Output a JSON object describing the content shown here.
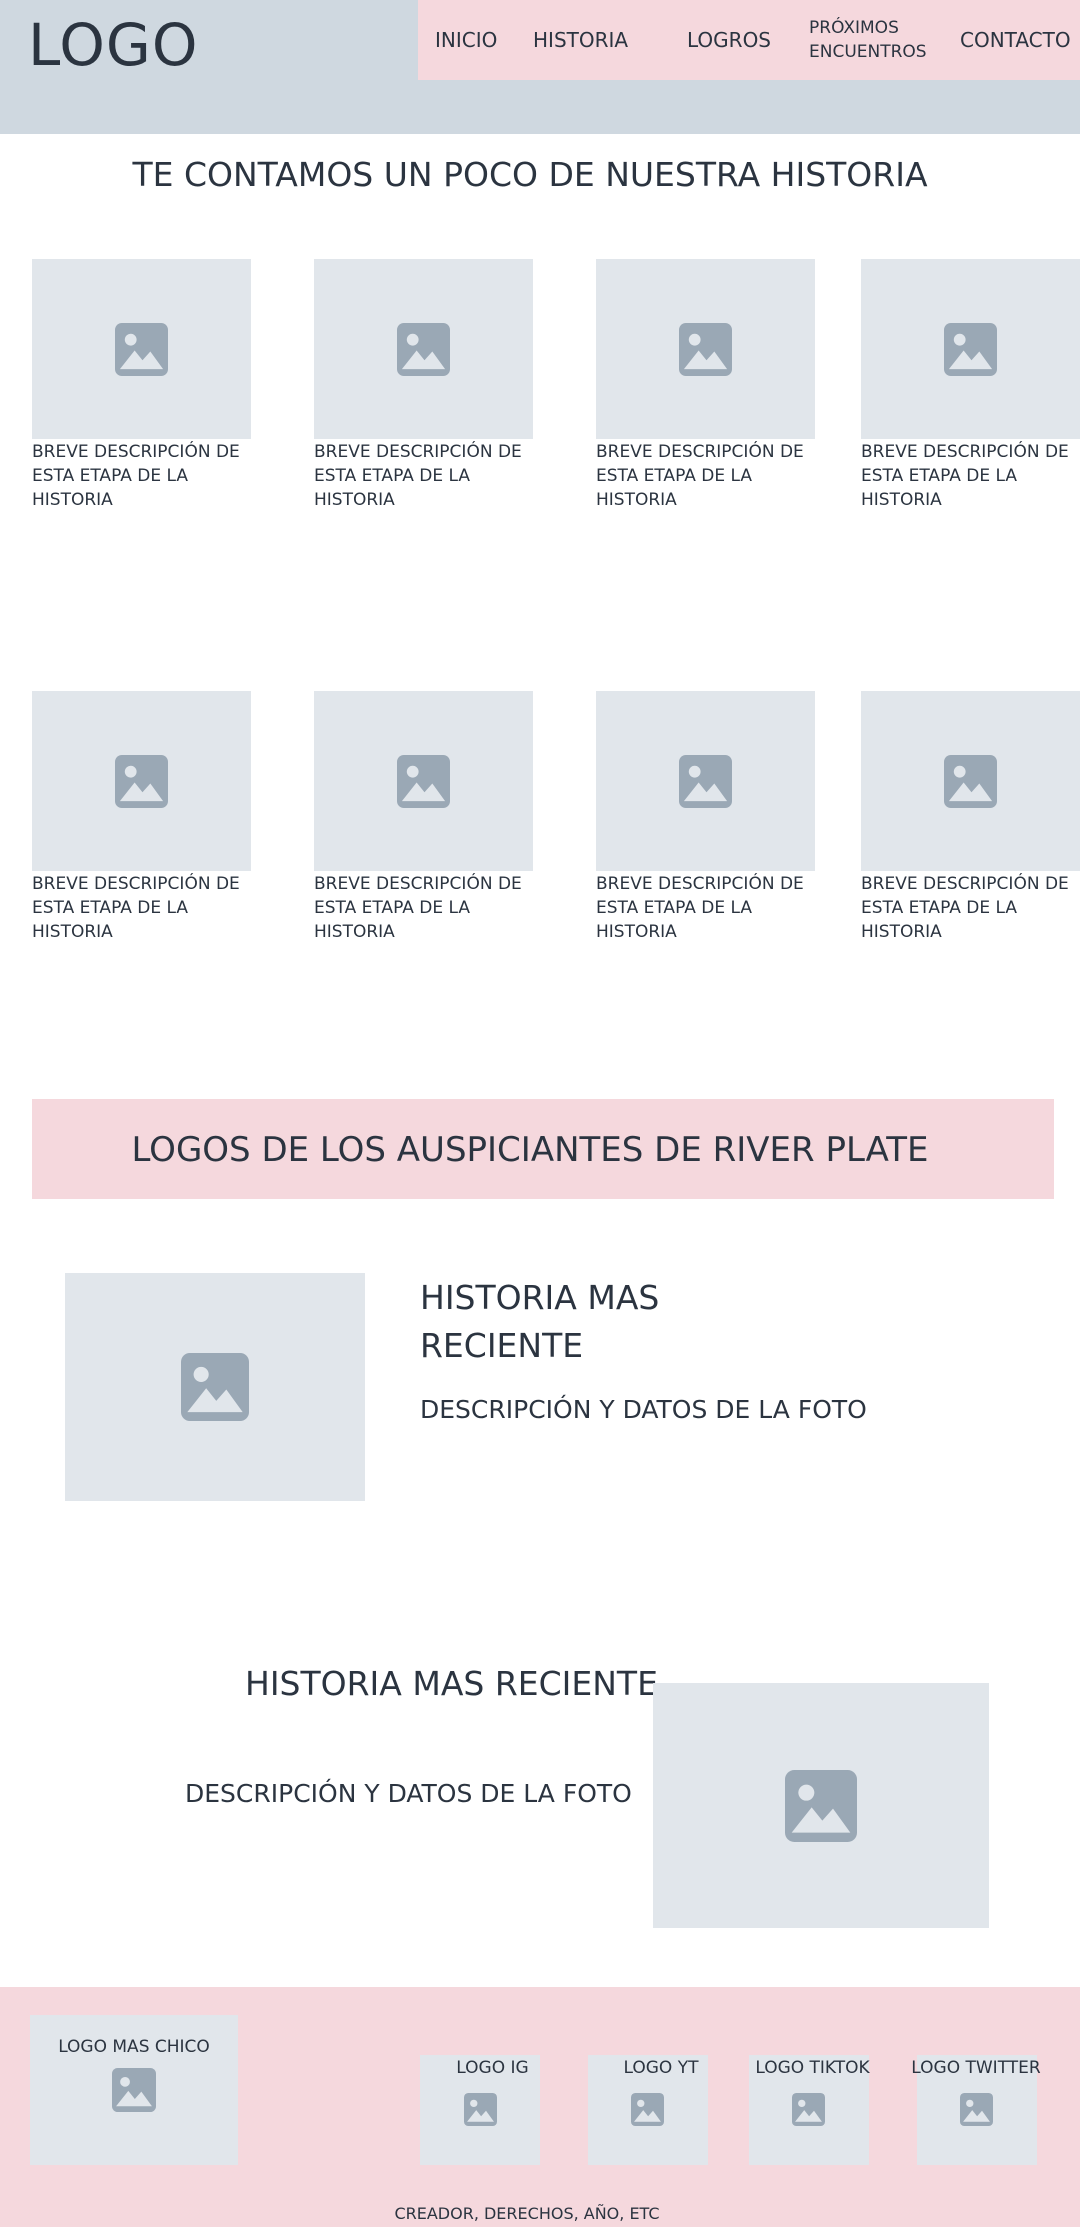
{
  "header": {
    "logo": "LOGO",
    "nav": [
      {
        "label": "INICIO"
      },
      {
        "label": "HISTORIA"
      },
      {
        "label": "LOGROS"
      },
      {
        "label": "PRÓXIMOS ENCUENTROS"
      },
      {
        "label": "CONTACTO"
      }
    ]
  },
  "main": {
    "title": "TE CONTAMOS UN POCO DE NUESTRA HISTORIA",
    "cards": [
      {
        "image_icon": "image-icon",
        "description": "BREVE DESCRIPCIÓN DE ESTA ETAPA DE LA HISTORIA"
      },
      {
        "image_icon": "image-icon",
        "description": "BREVE DESCRIPCIÓN DE ESTA ETAPA DE LA HISTORIA"
      },
      {
        "image_icon": "image-icon",
        "description": "BREVE DESCRIPCIÓN DE ESTA ETAPA DE LA HISTORIA"
      },
      {
        "image_icon": "image-icon",
        "description": "BREVE DESCRIPCIÓN DE ESTA ETAPA DE LA HISTORIA"
      },
      {
        "image_icon": "image-icon",
        "description": "BREVE DESCRIPCIÓN DE ESTA ETAPA DE LA HISTORIA"
      },
      {
        "image_icon": "image-icon",
        "description": "BREVE DESCRIPCIÓN DE ESTA ETAPA DE LA HISTORIA"
      },
      {
        "image_icon": "image-icon",
        "description": "BREVE DESCRIPCIÓN DE ESTA ETAPA DE LA HISTORIA"
      },
      {
        "image_icon": "image-icon",
        "description": "BREVE DESCRIPCIÓN DE ESTA ETAPA DE LA HISTORIA"
      }
    ]
  },
  "sponsors": {
    "text": "LOGOS DE LOS AUSPICIANTES DE RIVER PLATE"
  },
  "feature1": {
    "title_line1": "HISTORIA MAS",
    "title_line2": "RECIENTE",
    "description": "DESCRIPCIÓN Y DATOS DE LA FOTO"
  },
  "feature2": {
    "title": "HISTORIA MAS RECIENTE",
    "description": "DESCRIPCIÓN Y DATOS DE LA FOTO"
  },
  "footer": {
    "small_logo": "LOGO MAS CHICO",
    "social": [
      {
        "label": "LOGO IG"
      },
      {
        "label": "LOGO YT"
      },
      {
        "label": "LOGO TIKTOK"
      },
      {
        "label": "LOGO TWITTER"
      }
    ],
    "copyright": "CREADOR, DERECHOS, AÑO, ETC"
  },
  "colors": {
    "header_bg": "#cfd8e0",
    "accent_pink": "#f5d8dd",
    "placeholder_bg": "#e1e6eb",
    "placeholder_icon": "#9aa8b5",
    "text": "#2b3440"
  }
}
